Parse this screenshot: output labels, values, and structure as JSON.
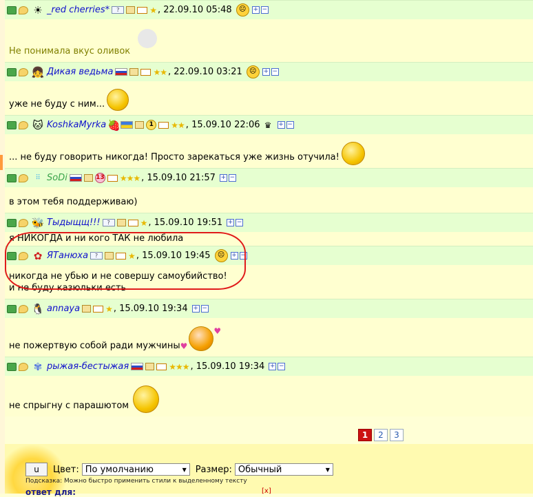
{
  "posts": [
    {
      "avatar": "sun-avatar",
      "nick": "_red cherries*",
      "date": "22.09.10 05:48",
      "stars": "★",
      "mood": "sad",
      "text": "Не понимала вкус оливок",
      "text_color": "#808000",
      "smiley": "angel-smiley"
    },
    {
      "avatar": "witch-avatar",
      "nick": "Дикая ведьма",
      "date": "22.09.10 03:21",
      "stars": "★★",
      "mood": "angry",
      "text": "уже не буду с ним...",
      "smiley": "crying-smiley"
    },
    {
      "avatar": "cat-avatar",
      "nick": "KoshkaMyrka",
      "date": "15.09.10 22:06",
      "stars": "★★",
      "badge": "1",
      "mood": "crown",
      "text": "... не буду говорить никогда! Просто зарекаться уже жизнь отучила!",
      "smiley": "shocked-smiley"
    },
    {
      "avatar": "dots-avatar",
      "nick": "SoDi",
      "date": "15.09.10 21:57",
      "stars": "★★★",
      "badge": "13",
      "text": "в этом тебя поддерживаю)"
    },
    {
      "avatar": "bee-avatar",
      "nick": "Тыдыщщ!!!",
      "date": "15.09.10 19:51",
      "stars": "★",
      "text": "я НИКОГДА и ни кого ТАК не любила"
    },
    {
      "avatar": "flower-avatar",
      "nick": "ЯТанюха",
      "date": "15.09.10 19:45",
      "stars": "★",
      "mood": "grumpy",
      "text_lines": [
        "никогда не убью и не совершу самоубийство!",
        "и не буду казюльки есть"
      ]
    },
    {
      "avatar": "penguin-avatar",
      "nick": "annaya",
      "date": "15.09.10 19:34",
      "stars": "★",
      "text": "не пожертвую собой ради мужчины",
      "smiley": "kiss-smiley"
    },
    {
      "avatar": "butterfly-avatar",
      "nick": "рыжая-бестыжая",
      "date": "15.09.10 19:34",
      "stars": "★★★",
      "text": "не спрыгну с парашютом",
      "smiley": "parachute-smiley"
    }
  ],
  "pagination": {
    "pages": [
      "1",
      "2",
      "3"
    ],
    "active": "1"
  },
  "editor": {
    "u_button": "u",
    "color_label": "Цвет:",
    "color_value": "По умолчанию",
    "size_label": "Размер:",
    "size_value": "Обычный",
    "hint": "Подсказка: Можно быстро применить стили к выделенному тексту",
    "reply_label": "ответ для:",
    "close": "[x]"
  },
  "colors": {
    "header_bg": "#e6ffd0",
    "body_bg": "#ffffd0",
    "nick": "#1010cc",
    "highlight": "#e01a1a",
    "active_page": "#cc1111"
  }
}
